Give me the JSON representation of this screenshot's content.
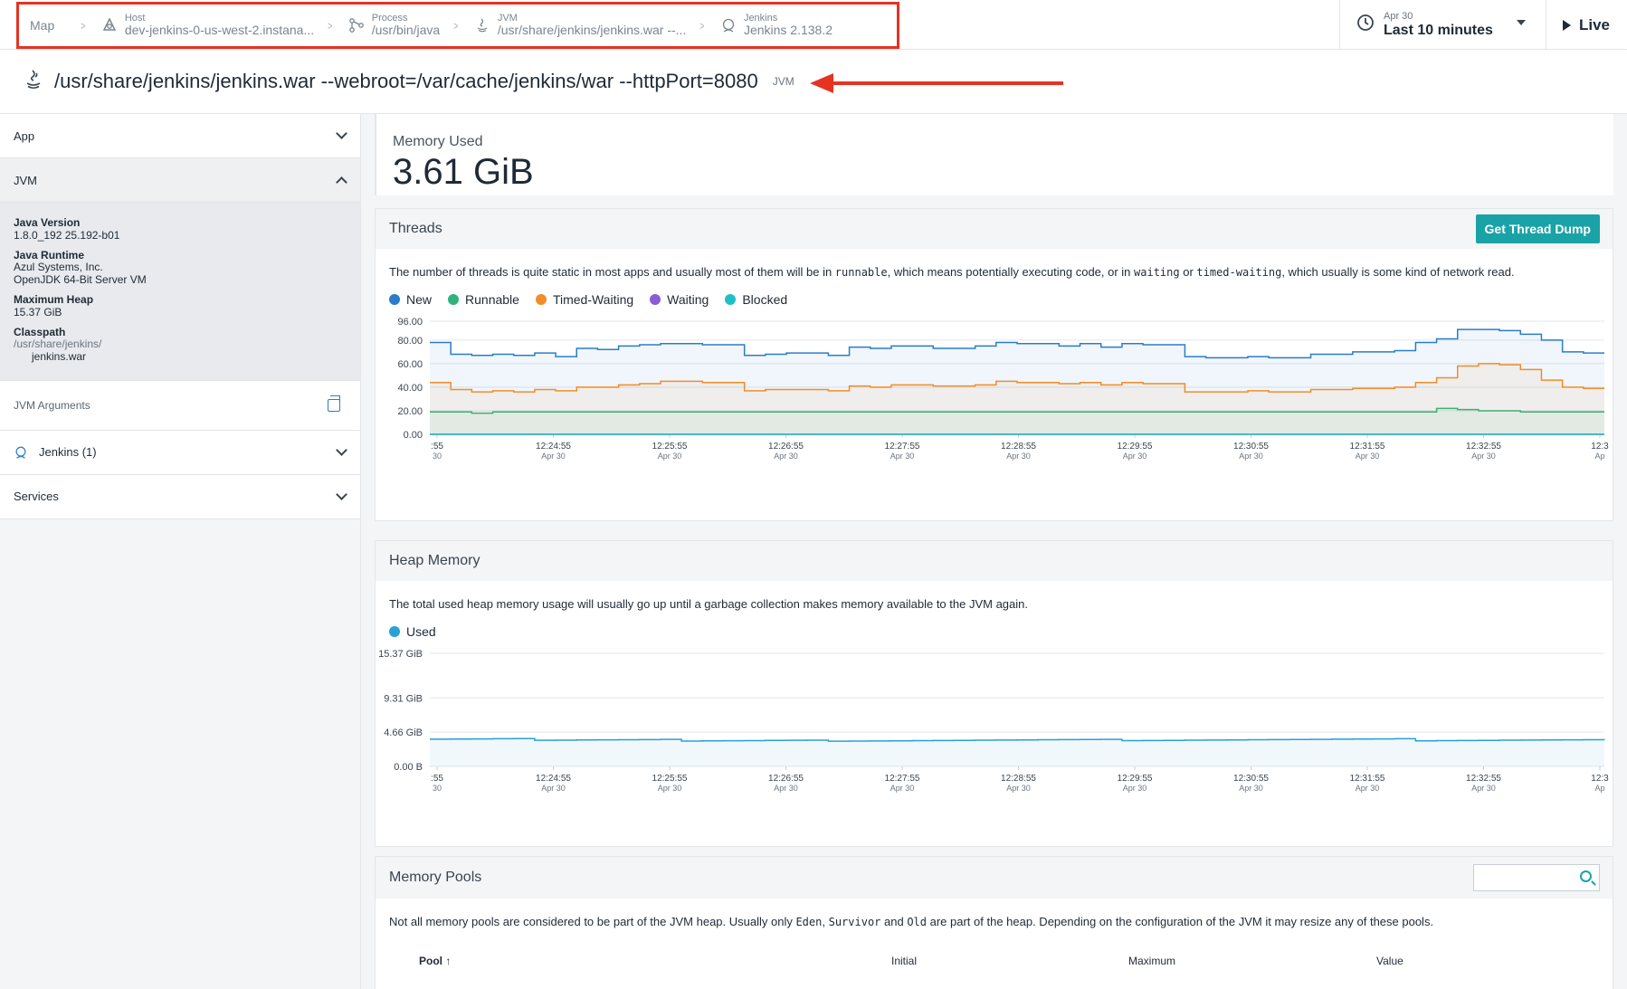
{
  "breadcrumbs": {
    "map": "Map",
    "items": [
      {
        "label": "Host",
        "value": "dev-jenkins-0-us-west-2.instana..."
      },
      {
        "label": "Process",
        "value": "/usr/bin/java"
      },
      {
        "label": "JVM",
        "value": "/usr/share/jenkins/jenkins.war --..."
      },
      {
        "label": "Jenkins",
        "value": "Jenkins 2.138.2"
      }
    ]
  },
  "timepicker": {
    "date": "Apr 30",
    "range": "Last 10 minutes"
  },
  "live": {
    "label": "Live"
  },
  "title": {
    "text": "/usr/share/jenkins/jenkins.war --webroot=/var/cache/jenkins/war --httpPort=8080",
    "badge": "JVM"
  },
  "sidebar": {
    "app": "App",
    "jvm": "JVM",
    "details": [
      {
        "key": "Java Version",
        "value": "1.8.0_192 25.192-b01"
      },
      {
        "key": "Java Runtime",
        "value": "Azul Systems, Inc.",
        "value2": "OpenJDK 64-Bit Server VM"
      },
      {
        "key": "Maximum Heap",
        "value": "15.37 GiB"
      }
    ],
    "classpath": {
      "key": "Classpath",
      "line1": "/usr/share/jenkins/",
      "line2": "jenkins.war"
    },
    "jvm_arguments": "JVM Arguments",
    "jenkins": "Jenkins (1)",
    "services": "Services"
  },
  "memory_used": {
    "label": "Memory Used",
    "value": "3.61 GiB"
  },
  "threads": {
    "title": "Threads",
    "button": "Get Thread Dump",
    "desc_1": "The number of threads is quite static in most apps and usually most of them will be in ",
    "code_1": "runnable",
    "desc_2": ", which means potentially executing code, or in ",
    "code_2": "waiting",
    "desc_3": " or ",
    "code_3": "timed-waiting",
    "desc_4": ", which usually is some kind of network read."
  },
  "heap": {
    "title": "Heap Memory",
    "desc": "The total used heap memory usage will usually go up until a garbage collection makes memory available to the JVM again."
  },
  "pools": {
    "title": "Memory Pools",
    "desc_1": "Not all memory pools are considered to be part of the JVM heap. Usually only ",
    "code_1": "Eden",
    "desc_2": ", ",
    "code_2": "Survivor",
    "desc_3": " and ",
    "code_3": "Old",
    "desc_4": " are part of the heap. Depending on the configuration of the JVM it may resize any of these pools.",
    "columns": [
      "Pool",
      "Initial",
      "Maximum",
      "Value"
    ]
  },
  "colors": {
    "new": "#2a7dc8",
    "runnable": "#2fb37a",
    "timed_waiting": "#f28c28",
    "waiting": "#8a5cd6",
    "blocked": "#1ec0c6",
    "accent": "#1aa3a6",
    "highlight": "#e53322"
  },
  "chart_data": [
    {
      "type": "line",
      "ylim": [
        0,
        96
      ],
      "yticks": [
        "96.00",
        "80.00",
        "60.00",
        "40.00",
        "20.00",
        "0.00"
      ],
      "xticks": [
        ":55",
        "12:24:55",
        "12:25:55",
        "12:26:55",
        "12:27:55",
        "12:28:55",
        "12:29:55",
        "12:30:55",
        "12:31:55",
        "12:32:55",
        "12:3"
      ],
      "xsub": [
        "30",
        "Apr 30",
        "Apr 30",
        "Apr 30",
        "Apr 30",
        "Apr 30",
        "Apr 30",
        "Apr 30",
        "Apr 30",
        "Apr 30",
        "Ap"
      ],
      "series": [
        {
          "name": "New",
          "values": [
            78,
            68,
            67,
            68,
            67,
            69,
            66,
            73,
            72,
            75,
            76,
            77,
            77,
            76,
            76,
            67,
            68,
            69,
            69,
            67,
            74,
            73,
            75,
            75,
            73,
            73,
            75,
            78,
            77,
            77,
            75,
            77,
            74,
            77,
            76,
            76,
            66,
            65,
            65,
            66,
            65,
            65,
            68,
            68,
            70,
            70,
            71,
            78,
            81,
            89,
            89,
            88,
            85,
            80,
            70,
            69,
            69
          ]
        },
        {
          "name": "Runnable",
          "values": [
            19,
            19,
            18,
            19,
            19,
            19,
            19,
            19,
            19,
            19,
            19,
            19,
            19,
            19,
            19,
            19,
            19,
            19,
            19,
            19,
            19,
            19,
            19,
            19,
            19,
            19,
            19,
            19,
            19,
            19,
            19,
            19,
            19,
            19,
            19,
            19,
            19,
            19,
            19,
            19,
            19,
            19,
            19,
            19,
            19,
            19,
            19,
            19,
            22,
            21,
            20,
            20,
            19,
            19,
            19,
            19,
            19
          ]
        },
        {
          "name": "Timed-Waiting",
          "values": [
            44,
            38,
            36,
            37,
            36,
            38,
            37,
            40,
            40,
            42,
            43,
            45,
            45,
            44,
            44,
            37,
            38,
            38,
            38,
            37,
            41,
            40,
            42,
            42,
            41,
            41,
            42,
            45,
            44,
            44,
            43,
            44,
            42,
            44,
            43,
            43,
            36,
            36,
            36,
            37,
            36,
            36,
            38,
            38,
            39,
            39,
            40,
            44,
            48,
            58,
            60,
            59,
            55,
            46,
            40,
            39,
            39
          ]
        },
        {
          "name": "Waiting",
          "values": [
            0,
            0,
            0,
            0,
            0,
            0,
            0,
            0,
            0,
            0,
            0,
            0,
            0,
            0,
            0,
            0,
            0,
            0,
            0,
            0,
            0,
            0,
            0,
            0,
            0,
            0,
            0,
            0,
            0,
            0,
            0,
            0,
            0,
            0,
            0,
            0,
            0,
            0,
            0,
            0,
            0,
            0,
            0,
            0,
            0,
            0,
            0,
            0,
            0,
            0,
            0,
            0,
            0,
            0,
            0,
            0,
            0
          ]
        },
        {
          "name": "Blocked",
          "values": [
            0,
            0,
            0,
            0,
            0,
            0,
            0,
            0,
            0,
            0,
            0,
            0,
            0,
            0,
            0,
            0,
            0,
            0,
            0,
            0,
            0,
            0,
            0,
            0,
            0,
            0,
            0,
            0,
            0,
            0,
            0,
            0,
            0,
            0,
            0,
            0,
            0,
            0,
            0,
            0,
            0,
            0,
            0,
            0,
            0,
            0,
            0,
            0,
            0,
            0,
            0,
            0,
            0,
            0,
            0,
            0,
            0
          ]
        }
      ]
    },
    {
      "type": "area",
      "ylim": [
        0,
        15.37
      ],
      "yticks": [
        "15.37 GiB",
        "9.31 GiB",
        "4.66 GiB",
        "0.00 B"
      ],
      "ytick_values": [
        15.37,
        9.31,
        4.66,
        0
      ],
      "xticks": [
        ":55",
        "12:24:55",
        "12:25:55",
        "12:26:55",
        "12:27:55",
        "12:28:55",
        "12:29:55",
        "12:30:55",
        "12:31:55",
        "12:32:55",
        "12:3"
      ],
      "xsub": [
        "30",
        "Apr 30",
        "Apr 30",
        "Apr 30",
        "Apr 30",
        "Apr 30",
        "Apr 30",
        "Apr 30",
        "Apr 30",
        "Apr 30",
        "Ap"
      ],
      "series": [
        {
          "name": "Used",
          "values": [
            3.7,
            3.72,
            3.74,
            3.76,
            3.78,
            3.55,
            3.57,
            3.59,
            3.61,
            3.63,
            3.65,
            3.67,
            3.45,
            3.47,
            3.49,
            3.51,
            3.53,
            3.55,
            3.57,
            3.42,
            3.44,
            3.46,
            3.48,
            3.5,
            3.52,
            3.54,
            3.56,
            3.58,
            3.6,
            3.62,
            3.64,
            3.66,
            3.68,
            3.5,
            3.52,
            3.54,
            3.56,
            3.58,
            3.6,
            3.62,
            3.64,
            3.66,
            3.68,
            3.7,
            3.72,
            3.74,
            3.76,
            3.48,
            3.5,
            3.52,
            3.54,
            3.56,
            3.58,
            3.6,
            3.61,
            3.62,
            3.61
          ]
        }
      ]
    }
  ]
}
